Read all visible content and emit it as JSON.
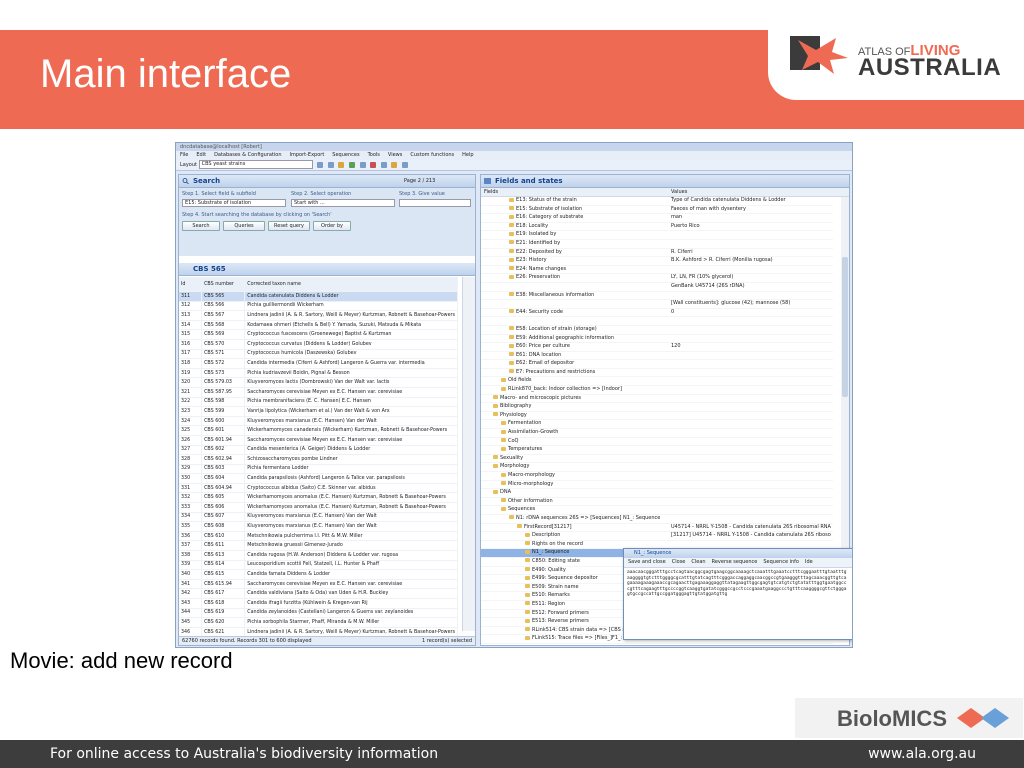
{
  "slide": {
    "title": "Main interface",
    "caption": "Movie: add new record",
    "logo_small": "ATLAS OF",
    "logo_living": "LIVING",
    "logo_big": "AUSTRALIA",
    "partner_logo": "BioloMICS",
    "footer_left": "For online access to Australia's biodiversity information",
    "footer_right": "www.ala.org.au",
    "colors": {
      "banner": "#ef6a52",
      "footer": "#3d3d3d"
    }
  },
  "app": {
    "window_title": "dncdatabase@localhost [Robert]",
    "menu": [
      "File",
      "Edit",
      "Databases & Configuration",
      "Import-Export",
      "Sequences",
      "Tools",
      "Views",
      "Custom functions",
      "Help"
    ],
    "layout_label": "Layout",
    "layout_value": "CBS yeast strains",
    "search": {
      "title": "Search",
      "page": "Page 2 / 213",
      "step1": "Step 1. Select field & subfield",
      "step2": "Step 2. Select operation",
      "step3": "Step 3. Give value",
      "field_value": "E15: Substrate of isolation",
      "operation_value": "Start with ...",
      "step4": "Step 4. Start searching the database by clicking on 'Search'",
      "buttons": [
        "Search",
        "Queries",
        "Reset query",
        "Order by"
      ]
    },
    "records": {
      "title": "CBS 565",
      "columns": [
        "Id",
        "CBS number",
        "Corrected taxon name"
      ],
      "rows": [
        [
          "311",
          "CBS 565",
          "Candida catenulata Diddens & Lodder"
        ],
        [
          "312",
          "CBS 566",
          "Pichia guilliermondii Wickerham"
        ],
        [
          "313",
          "CBS 567",
          "Lindnera jadinii (A. & R. Sartory, Weill & Meyer) Kurtzman, Robnett & Basehoar-Powers"
        ],
        [
          "314",
          "CBS 568",
          "Kodamaea ohmeri (Etchells & Bell) Y. Yamada, Suzuki, Matsuda & Mikata"
        ],
        [
          "315",
          "CBS 569",
          "Cryptococcus fuscescens (Groenewege) Baptist & Kurtzman"
        ],
        [
          "316",
          "CBS 570",
          "Cryptococcus curvatus (Diddens & Lodder) Golubev"
        ],
        [
          "317",
          "CBS 571",
          "Cryptococcus humicola (Daszewska) Golubev"
        ],
        [
          "318",
          "CBS 572",
          "Candida intermedia (Ciferri & Ashford) Langeron & Guerra var. intermedia"
        ],
        [
          "319",
          "CBS 573",
          "Pichia kudriavzevii Boidin, Pignal & Besson"
        ],
        [
          "320",
          "CBS 579.03",
          "Kluyveromyces lactis (Dombrowski) Van der Walt var. lactis"
        ],
        [
          "321",
          "CBS 587.95",
          "Saccharomyces cerevisiae Meyen ex E.C. Hansen var. cerevisiae"
        ],
        [
          "322",
          "CBS 598",
          "Pichia membranifaciens (E. C. Hansen) E.C. Hansen"
        ],
        [
          "323",
          "CBS 599",
          "Vanrija lipolytica (Wickerham et al.) Van der Walt & von Arx"
        ],
        [
          "324",
          "CBS 600",
          "Kluyveromyces marxianus (E.C. Hansen) Van der Walt"
        ],
        [
          "325",
          "CBS 601",
          "Wickerhamomyces canadensis (Wickerham) Kurtzman, Robnett & Basehoar-Powers"
        ],
        [
          "326",
          "CBS 601.94",
          "Saccharomyces cerevisiae Meyen ex E.C. Hansen var. cerevisiae"
        ],
        [
          "327",
          "CBS 602",
          "Candida mesenterica (A. Geiger) Diddens & Lodder"
        ],
        [
          "328",
          "CBS 602.94",
          "Schizosaccharomyces pombe Lindner"
        ],
        [
          "329",
          "CBS 603",
          "Pichia fermentans Lodder"
        ],
        [
          "330",
          "CBS 604",
          "Candida parapsilosis (Ashford) Langeron & Talice var. parapsilosis"
        ],
        [
          "331",
          "CBS 604.94",
          "Cryptococcus albidus (Saito) C.E. Skinner var. albidus"
        ],
        [
          "332",
          "CBS 605",
          "Wickerhamomyces anomalus (E.C. Hansen) Kurtzman, Robnett & Basehoar-Powers"
        ],
        [
          "333",
          "CBS 606",
          "Wickerhamomyces anomalus (E.C. Hansen) Kurtzman, Robnett & Basehoar-Powers"
        ],
        [
          "334",
          "CBS 607",
          "Kluyveromyces marxianus (E.C. Hansen) Van der Walt"
        ],
        [
          "335",
          "CBS 608",
          "Kluyveromyces marxianus (E.C. Hansen) Van der Walt"
        ],
        [
          "336",
          "CBS 610",
          "Metschnikowia pulcherrima I.I. Pitt & M.W. Miller"
        ],
        [
          "337",
          "CBS 611",
          "Metschnikowia gruessii Gimenez-Jurado"
        ],
        [
          "338",
          "CBS 613",
          "Candida rugosa (H.W. Anderson) Diddens & Lodder var. rugosa"
        ],
        [
          "339",
          "CBS 614",
          "Leucosporidium scottii Fell, Statzell, I.L. Hunter & Phaff"
        ],
        [
          "340",
          "CBS 615",
          "Candida famata Diddens & Lodder"
        ],
        [
          "341",
          "CBS 615.94",
          "Saccharomyces cerevisiae Meyen ex E.C. Hansen var. cerevisiae"
        ],
        [
          "342",
          "CBS 617",
          "Candida valdiviana (Saito & Oda) van Uden & H.R. Buckley"
        ],
        [
          "343",
          "CBS 618",
          "Candida ifragii furzitta (Kühlwein & Kregen-van Rij"
        ],
        [
          "344",
          "CBS 619",
          "Candida zeylanoides (Castellani) Langeron & Guerra var. zeylanoides"
        ],
        [
          "345",
          "CBS 620",
          "Pichia sorbophila Starmer, Phaff, Miranda & M.W. Miller"
        ],
        [
          "346",
          "CBS 621",
          "Lindnera jadinii (A. & R. Sartory, Weill & Meyer) Kurtzman, Robnett & Basehoar-Powers"
        ]
      ],
      "status_left": "62760 records found. Records 301 to 600 displayed",
      "status_right": "1 record(s) selected"
    },
    "fields": {
      "title": "Fields and states",
      "col_fields": "Fields",
      "col_values": "Values",
      "rows": [
        {
          "label": "E13: Status of the strain",
          "value": "Type of Candida catenulata Diddens & Lodder",
          "indent": 3
        },
        {
          "label": "E15: Substrate of isolation",
          "value": "Faeces of man with dysentery",
          "indent": 3
        },
        {
          "label": "E16: Category of substrate",
          "value": "man",
          "indent": 3
        },
        {
          "label": "E18: Locality",
          "value": "Puerto Rico",
          "indent": 3
        },
        {
          "label": "E19: Isolated by",
          "value": "",
          "indent": 3
        },
        {
          "label": "E21: Identified by",
          "value": "",
          "indent": 3
        },
        {
          "label": "E22: Deposited by",
          "value": "R. Ciferri",
          "indent": 3
        },
        {
          "label": "E23: History",
          "value": "B.K. Ashford > R. Ciferri (Monilia rugosa)",
          "indent": 3
        },
        {
          "label": "E24: Name changes",
          "value": "",
          "indent": 3
        },
        {
          "label": "E26: Preservation",
          "value": "LY, LN, FR (10% glycerol)",
          "indent": 3
        },
        {
          "label": "",
          "value": "GenBank U45714 (26S rDNA)",
          "indent": 3
        },
        {
          "label": "E38: Miscellaneous information",
          "value": "",
          "indent": 3
        },
        {
          "label": "",
          "value": "[Wall constituents]: glucose (42); mannose (58)",
          "indent": 3
        },
        {
          "label": "E44: Security code",
          "value": "0",
          "indent": 3
        },
        {
          "label": "",
          "value": "",
          "indent": 3
        },
        {
          "label": "E58: Location of strain (storage)",
          "value": "",
          "indent": 3
        },
        {
          "label": "E59: Additional geographic information",
          "value": "",
          "indent": 3
        },
        {
          "label": "E60: Price per culture",
          "value": "120",
          "indent": 3
        },
        {
          "label": "E61: DNA location",
          "value": "",
          "indent": 3
        },
        {
          "label": "E62: Email of depositor",
          "value": "",
          "indent": 3
        },
        {
          "label": "E7: Precautions and restrictions",
          "value": "",
          "indent": 3
        },
        {
          "label": "Old fields",
          "value": "",
          "indent": 2
        },
        {
          "label": "RLink870_back: Indoor collection => [Indoor]",
          "value": "",
          "indent": 2
        },
        {
          "label": "Macro- and microscopic pictures",
          "value": "",
          "indent": 1
        },
        {
          "label": "Bibliography",
          "value": "",
          "indent": 1
        },
        {
          "label": "Physiology",
          "value": "",
          "indent": 1
        },
        {
          "label": "Fermentation",
          "value": "",
          "indent": 2
        },
        {
          "label": "Assimilation-Growth",
          "value": "",
          "indent": 2
        },
        {
          "label": "CoQ",
          "value": "",
          "indent": 2
        },
        {
          "label": "Temperatures",
          "value": "",
          "indent": 2
        },
        {
          "label": "Sexuality",
          "value": "",
          "indent": 1
        },
        {
          "label": "Morphology",
          "value": "",
          "indent": 1
        },
        {
          "label": "Macro-morphology",
          "value": "",
          "indent": 2
        },
        {
          "label": "Micro-morphology",
          "value": "",
          "indent": 2
        },
        {
          "label": "DNA",
          "value": "",
          "indent": 1
        },
        {
          "label": "Other information",
          "value": "",
          "indent": 2
        },
        {
          "label": "Sequences",
          "value": "",
          "indent": 2
        },
        {
          "label": "N1: rDNA sequences 26S => [Sequences] N1_: Sequence",
          "value": "",
          "indent": 3
        },
        {
          "label": "FirstRecord[31217]",
          "value": "U45714 - NRRL Y-1508 - Candida catenulata 26S ribosomal RNA gene par",
          "indent": 4
        },
        {
          "label": "Description",
          "value": "[31217] U45714 - NRRL Y-1508 - Candida catenulata 26S ribosomal RNA g",
          "indent": 5
        },
        {
          "label": "Rights on the record",
          "value": "",
          "indent": 5
        },
        {
          "label": "N1_: Sequence",
          "value": "aaacaacgggatttgcctcagtaacggcgagtgaagcggcaaaagctcaaatttgaaatcctttcgggaat",
          "indent": 5,
          "hi": true
        },
        {
          "label": "C850: Editing state",
          "value": "",
          "indent": 5
        },
        {
          "label": "E490: Quality",
          "value": "",
          "indent": 5
        },
        {
          "label": "E499: Sequence depositor",
          "value": "",
          "indent": 5
        },
        {
          "label": "E509: Strain name",
          "value": "",
          "indent": 5
        },
        {
          "label": "E510: Remarks",
          "value": "",
          "indent": 5
        },
        {
          "label": "E511: Region",
          "value": "",
          "indent": 5
        },
        {
          "label": "E512: Forward primers",
          "value": "",
          "indent": 5
        },
        {
          "label": "E513: Reverse primers",
          "value": "",
          "indent": 5
        },
        {
          "label": "RLink514: CBS strain data => [CBS strai",
          "value": "",
          "indent": 5
        },
        {
          "label": "FLink515: Trace files => [Files_]F1_: File content",
          "value": "",
          "indent": 5
        }
      ]
    },
    "popup": {
      "title": "N1_: Sequence",
      "toolbar": [
        "Save and close",
        "Close",
        "Clean",
        "Reverse sequence",
        "Sequence info",
        "Ide"
      ],
      "sequence": "aaacaacgggatttgcctcagtaacggcgagtgaagcggcaaaagctcaaatttgaaatcctttcgggaatttgtaatttgaaggggtgtctttggggcgcatttgtatcagtttcgggaccaggaggcaacggccgtgaagggtttagcaaacggttgtcagaaaagaaagaaaccgcagaacttgagaaaggaggttatagaagttggcgagtgtcatgtctgtatatttggtgaatggcccgtttcagaagtttgccccggtcaaggtgatatcgggccgcctcccgaaatgaaggccctgtttcaaggggcgttctgggagtgccgccattgccggatgggagttgtatggatgttg"
    }
  }
}
